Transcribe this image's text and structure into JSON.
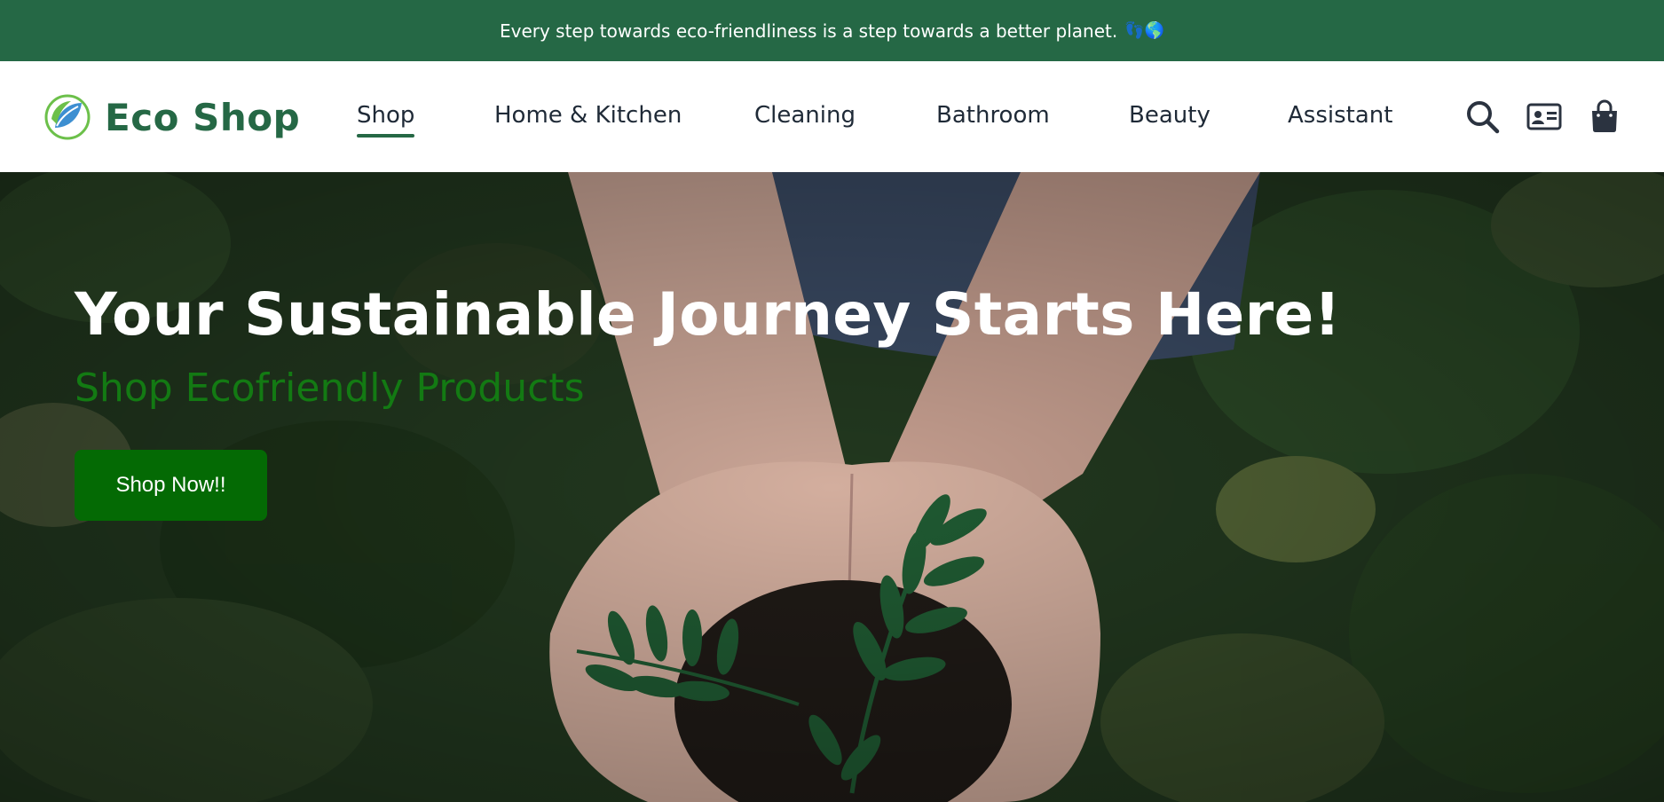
{
  "announcement": {
    "text": "Every step towards eco-friendliness is a step towards a better planet.",
    "emoji": "👣🌎"
  },
  "brand": {
    "name": "Eco Shop",
    "logo_icon": "leaf-globe-logo"
  },
  "nav": {
    "items": [
      {
        "label": "Shop",
        "active": true
      },
      {
        "label": "Home & Kitchen",
        "active": false
      },
      {
        "label": "Cleaning",
        "active": false
      },
      {
        "label": "Bathroom",
        "active": false
      },
      {
        "label": "Beauty",
        "active": false
      },
      {
        "label": "Assistant",
        "active": false
      }
    ],
    "icons": [
      "search-icon",
      "contact-card-icon",
      "shopping-bag-icon"
    ]
  },
  "hero": {
    "title": "Your Sustainable Journey Starts Here!",
    "subtitle": "Shop Ecofriendly Products",
    "cta_label": "Shop Now!!",
    "image": "hands-holding-soil-and-seedling"
  },
  "colors": {
    "brand_green": "#256845",
    "cta_green": "#046a04",
    "subtitle_green": "#137a13"
  }
}
